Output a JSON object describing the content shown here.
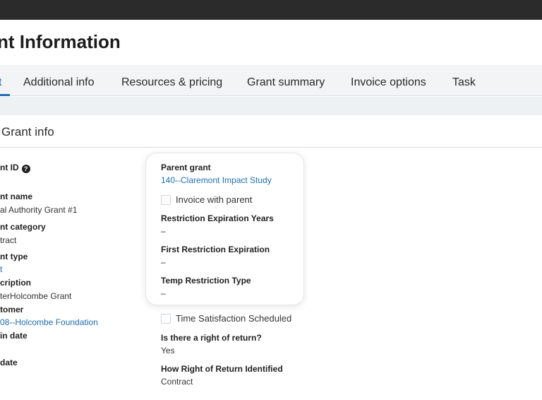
{
  "page": {
    "title": "nt Information"
  },
  "tabs": [
    {
      "label": "t",
      "active": true
    },
    {
      "label": "Additional info"
    },
    {
      "label": "Resources & pricing"
    },
    {
      "label": "Grant summary"
    },
    {
      "label": "Invoice options"
    },
    {
      "label": "Task"
    }
  ],
  "section": {
    "title": "Grant info"
  },
  "left_fields": {
    "grant_id": {
      "label": "nt ID"
    },
    "grant_name": {
      "label": "nt name",
      "value": "al Authority Grant #1"
    },
    "grant_category": {
      "label": "nt category",
      "value": "tract"
    },
    "grant_type": {
      "label": "nt type",
      "value": "t"
    },
    "description": {
      "label": "cription",
      "value": "terHolcombe Grant"
    },
    "customer": {
      "label": "tomer",
      "value": "08--Holcombe Foundation"
    },
    "begin_date": {
      "label": "in date"
    },
    "end_date": {
      "label": "date"
    }
  },
  "card": {
    "parent_grant": {
      "label": "Parent grant",
      "value": "140--Claremont Impact Study"
    },
    "invoice_with_parent": {
      "label": "Invoice with parent",
      "checked": false
    },
    "restriction_expiration_years": {
      "label": "Restriction Expiration Years",
      "value": "–"
    },
    "first_restriction_expiration": {
      "label": "First Restriction Expiration",
      "value": "–"
    },
    "temp_restriction_type": {
      "label": "Temp Restriction Type",
      "value": "–"
    }
  },
  "right_fields": {
    "time_satisfaction": {
      "label": "Time Satisfaction Scheduled",
      "checked": false
    },
    "right_of_return": {
      "label": "Is there a right of return?",
      "value": "Yes"
    },
    "how_identified": {
      "label": "How Right of Return Identified",
      "value": "Contract"
    }
  },
  "icons": {
    "help": "help-icon"
  },
  "colors": {
    "accent": "#1f6fb2",
    "topbar": "#2b2b2b"
  }
}
